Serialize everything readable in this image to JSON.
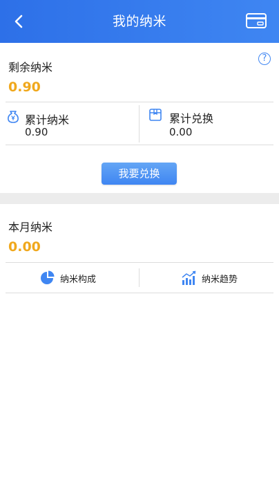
{
  "header": {
    "title": "我的纳米",
    "back_icon": "chevron-left-icon",
    "card_icon": "vip-card-icon"
  },
  "balance": {
    "label": "剩余纳米",
    "value": "0.90",
    "help_glyph": "?"
  },
  "stats": {
    "accumulated": {
      "label": "累计纳米",
      "value": "0.90",
      "icon": "yuan-bag-icon"
    },
    "exchanged": {
      "label": "累计兑换",
      "value": "0.00",
      "icon": "gift-box-icon"
    }
  },
  "exchange_button": "我要兑换",
  "month": {
    "label": "本月纳米",
    "value": "0.00"
  },
  "tools": {
    "composition": {
      "label": "纳米构成",
      "icon": "pie-chart-icon"
    },
    "trend": {
      "label": "纳米趋势",
      "icon": "trend-chart-icon"
    }
  },
  "colors": {
    "primary": "#3f86f2",
    "accent": "#f0a81d",
    "divider": "#dcdcdc",
    "band": "#ececec"
  }
}
